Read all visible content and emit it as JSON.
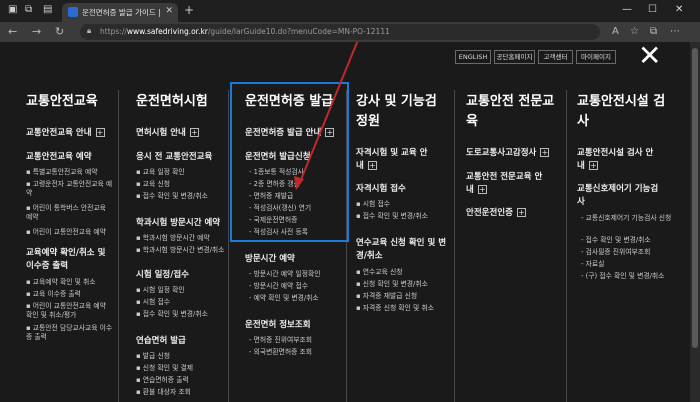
{
  "browser": {
    "tab_title": "운전면허증 발급 가이드 | 도로교",
    "url_host": "www.safedriving.or.kr",
    "url_prefix": "https://",
    "url_path": "/guide/larGuide10.do?menuCode=MN-PO-12111"
  },
  "toplinks": [
    "ENGLISH",
    "공단홈페이지",
    "고객센터",
    "마이페이지"
  ],
  "columns": [
    {
      "title": [
        "교통안전교육"
      ],
      "items": [
        {
          "label": "교통안전교육 안내",
          "plus": true
        },
        {
          "label": "교통안전교육 예약",
          "subs": [
            "특별교통안전교육 예약",
            "고령운전자 교통안전교육 예약",
            "어린이 통학버스 안전교육 예약",
            "어린이 교통안전교육 예약"
          ]
        },
        {
          "label": "교육예약 확인/취소 및",
          "label2": "이수증 출력",
          "subs": [
            "교육예약 확인 및 취소",
            "교육 이수증 출력",
            "어린이 교통안전교육 예약 확인 및 취소/평가",
            "교통안전 담당교사교육 이수증 출력"
          ]
        }
      ]
    },
    {
      "title": [
        "운전면허시험"
      ],
      "items": [
        {
          "label": "면허시험 안내",
          "plus": true
        },
        {
          "label": "응시 전 교통안전교육",
          "subs": [
            "교육 일정 확인",
            "교육 신청",
            "접수 확인 및 변경/취소"
          ]
        },
        {
          "label": "학과시험 방문시간 예약",
          "subs": [
            "학과시험 방문시간 예약",
            "학과시험 방문시간 변경/취소"
          ]
        },
        {
          "label": "시험 일정/접수",
          "subs": [
            "시험 일정 확인",
            "시험 접수",
            "접수 확인 및 변경/취소"
          ]
        },
        {
          "label": "연습면허 발급",
          "subs": [
            "발급 신청",
            "신청 확인 및 결제",
            "연습면허증 출력",
            "환불 대상자 조회"
          ]
        }
      ]
    },
    {
      "title": [
        "운전면허증 발급"
      ],
      "items": [
        {
          "label": "운전면허증 발급 안내",
          "plus": true
        },
        {
          "label": "운전면허 발급신청",
          "subs": [
            "1종보통 적성검사",
            "2종 면허증 갱신",
            "면허증 재발급",
            "적성검사(갱신) 연기",
            "국제운전면허증",
            "적성검사 사전 등록"
          ]
        },
        {
          "label": "방문시간 예약",
          "subs": [
            "방문시간 예약 일정확인",
            "방문시간 예약 접수",
            "예약 확인 및 변경/취소"
          ]
        },
        {
          "label": "운전면허 정보조회",
          "subs": [
            "면허증 진위여부조회",
            "외국변환면허증 조회"
          ]
        }
      ]
    },
    {
      "title": [
        "강사 및 기능검",
        "정원"
      ],
      "items": [
        {
          "label": "자격시험 및 교육 안",
          "label2": "내",
          "plus": true
        },
        {
          "label": "자격시험 접수",
          "subs": [
            "시험 접수",
            "접수 확인 및 변경/취소"
          ]
        },
        {
          "label": "연수교육 신청 확인 및 변",
          "label2": "경/취소",
          "subs": [
            "연수교육 신청",
            "신청 확인 및 변경/취소",
            "자격증 재발급 신청",
            "자격증 신청 확인 및 취소"
          ]
        }
      ]
    },
    {
      "title": [
        "교통안전 전문교",
        "육"
      ],
      "items": [
        {
          "label": "도로교통사고감정사",
          "plus": true
        },
        {
          "label": "교통안전 전문교육 안",
          "label2": "내",
          "plus": true
        },
        {
          "label": "안전운전인증",
          "plus": true
        }
      ]
    },
    {
      "title": [
        "교통안전시설 검",
        "사"
      ],
      "items": [
        {
          "label": "교통안전시설 검사 안",
          "label2": "내",
          "plus": true
        },
        {
          "label": "교통신호제어기 기능검",
          "label2": "사",
          "subs": [
            "교통신호제어기 기능검사 신청",
            "접수 확인 및 변경/취소",
            "검사필증 진위여부조회",
            "자료실",
            "(구) 접수 확인 및 변경/취소"
          ]
        }
      ]
    }
  ],
  "icons": {
    "close": "close-icon",
    "plus": "plus-box-icon",
    "accent": "#1e78d8",
    "arrow_color": "#c0282b"
  }
}
